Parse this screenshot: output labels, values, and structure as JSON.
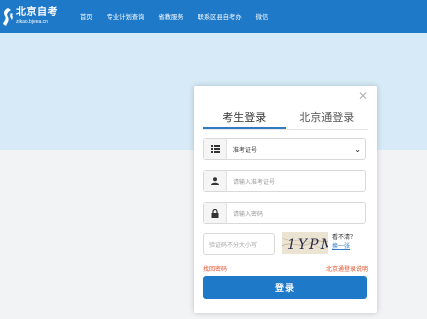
{
  "header": {
    "logo_cn": "北京自考",
    "logo_en": "zikao.bjeea.cn",
    "nav": [
      "首页",
      "专业计划查询",
      "省教服务",
      "联系区县自考办",
      "微信"
    ]
  },
  "login": {
    "tabs": [
      "考生登录",
      "北京通登录"
    ],
    "close_glyph": "✕",
    "id_type_selected": "准考证号",
    "id_placeholder": "请输入准考证号",
    "password_placeholder": "请输入密码",
    "captcha_placeholder": "验证码不分大小写",
    "captcha_text": "1YPM",
    "captcha_hint": "看不清？",
    "captcha_refresh": "换一张",
    "forgot_password": "找回密码",
    "bjt_help": "北京通登录说明",
    "submit": "登录"
  },
  "colors": {
    "header_bg": "#1f79c9",
    "banner_bg": "#d6eaf7",
    "button_bg": "#1f79c9",
    "link_red": "#e2502b"
  },
  "icons": [
    "logo-mark-icon",
    "list-icon",
    "user-icon",
    "lock-icon",
    "chevron-down-icon",
    "close-icon"
  ]
}
